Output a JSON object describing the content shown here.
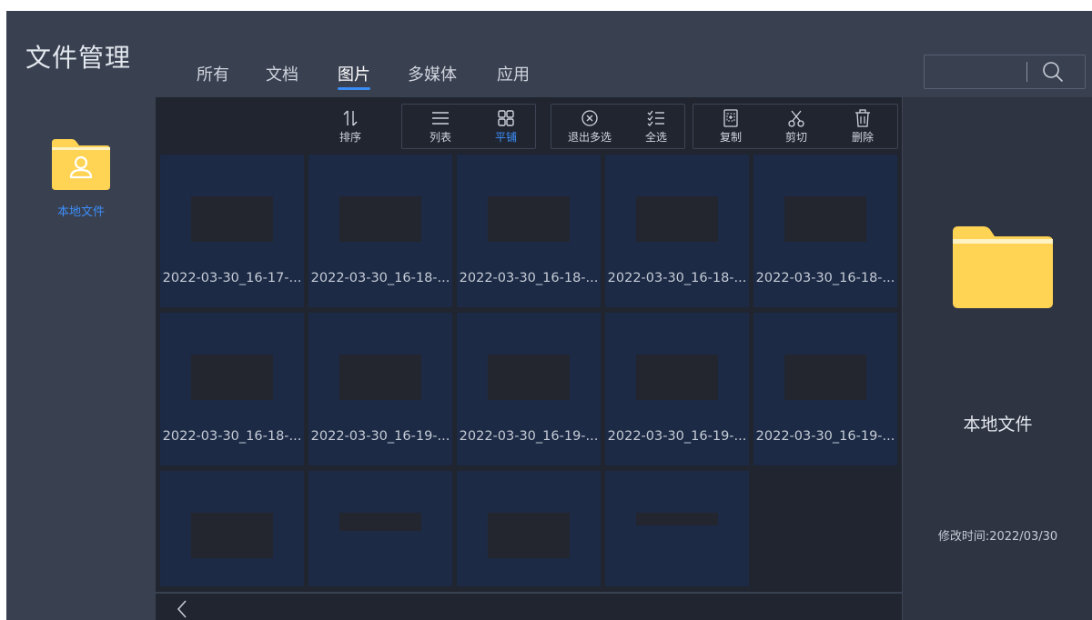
{
  "app": {
    "title": "文件管理"
  },
  "tabs": [
    {
      "label": "所有",
      "active": false
    },
    {
      "label": "文档",
      "active": false
    },
    {
      "label": "图片",
      "active": true
    },
    {
      "label": "多媒体",
      "active": false
    },
    {
      "label": "应用",
      "active": false
    }
  ],
  "search": {
    "icon": "search-icon",
    "value": ""
  },
  "sidebar": {
    "items": [
      {
        "label": "本地文件",
        "icon": "folder-user-icon",
        "selected": true
      }
    ]
  },
  "toolbar": {
    "sort": {
      "label": "排序",
      "icon": "sort-icon"
    },
    "list": {
      "label": "列表",
      "icon": "list-view-icon"
    },
    "tile": {
      "label": "平铺",
      "icon": "grid-view-icon",
      "active": true
    },
    "exit_multi": {
      "label": "退出多选",
      "icon": "close-circle-icon"
    },
    "select_all": {
      "label": "全选",
      "icon": "checklist-icon"
    },
    "copy": {
      "label": "复制",
      "icon": "copy-icon"
    },
    "cut": {
      "label": "剪切",
      "icon": "scissors-icon"
    },
    "delete": {
      "label": "删除",
      "icon": "trash-icon"
    }
  },
  "files": [
    {
      "name": "2022-03-30_16-17-..."
    },
    {
      "name": "2022-03-30_16-18-..."
    },
    {
      "name": "2022-03-30_16-18-..."
    },
    {
      "name": "2022-03-30_16-18-..."
    },
    {
      "name": "2022-03-30_16-18-..."
    },
    {
      "name": "2022-03-30_16-18-..."
    },
    {
      "name": "2022-03-30_16-19-..."
    },
    {
      "name": "2022-03-30_16-19-..."
    },
    {
      "name": "2022-03-30_16-19-..."
    },
    {
      "name": "2022-03-30_16-19-..."
    },
    {
      "name": ""
    },
    {
      "name": ""
    },
    {
      "name": ""
    },
    {
      "name": ""
    }
  ],
  "details": {
    "name": "本地文件",
    "modified": "修改时间:2022/03/30"
  },
  "colors": {
    "accent": "#3b8cf5",
    "folder": "#ffd454",
    "tile_bg": "#1c2a45"
  }
}
